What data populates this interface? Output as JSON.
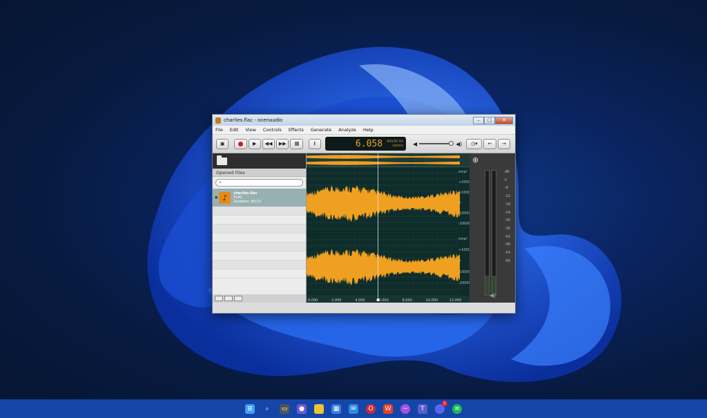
{
  "window": {
    "title": "charlies.flac - ocenaudio"
  },
  "menu": [
    "File",
    "Edit",
    "View",
    "Controls",
    "Effects",
    "Generate",
    "Analyze",
    "Help"
  ],
  "toolbar": {
    "time": "6.058",
    "sample_rate": "44100 Hz",
    "channels": "stereo",
    "info_label": "i"
  },
  "sidebar": {
    "header": "Opened Files",
    "file": {
      "name": "charlies.flac",
      "format": "FLAC",
      "duration": "Duration: 00:13"
    }
  },
  "editor": {
    "y_labels_top": [
      "smpl",
      "+20000",
      "+10000",
      "0",
      "-10000",
      "-20000"
    ],
    "y_labels_bottom": [
      "smpl",
      "+10000",
      "0",
      "-10000",
      "-20000"
    ],
    "x_labels": [
      "0.000",
      "2.000",
      "4.000",
      "6.000",
      "8.000",
      "10.000",
      "12.000"
    ],
    "playhead_seconds": 6.058,
    "duration_seconds": 13
  },
  "meters": {
    "db_labels": [
      "dB",
      "0",
      "-6",
      "-12",
      "-18",
      "-24",
      "-30",
      "-36",
      "-42",
      "-48",
      "-54",
      "-60"
    ]
  },
  "colors": {
    "waveform": "#f0a020",
    "editor_bg": "#0d2624"
  },
  "taskbar": {
    "icons": [
      "windows-start-icon",
      "search-icon",
      "task-view-icon",
      "chat-icon",
      "file-explorer-icon",
      "store-icon",
      "mail-icon",
      "opera-icon",
      "office-icon",
      "messenger-icon",
      "teams-icon",
      "discord-icon",
      "spotify-icon"
    ],
    "discord_badge": "1"
  }
}
